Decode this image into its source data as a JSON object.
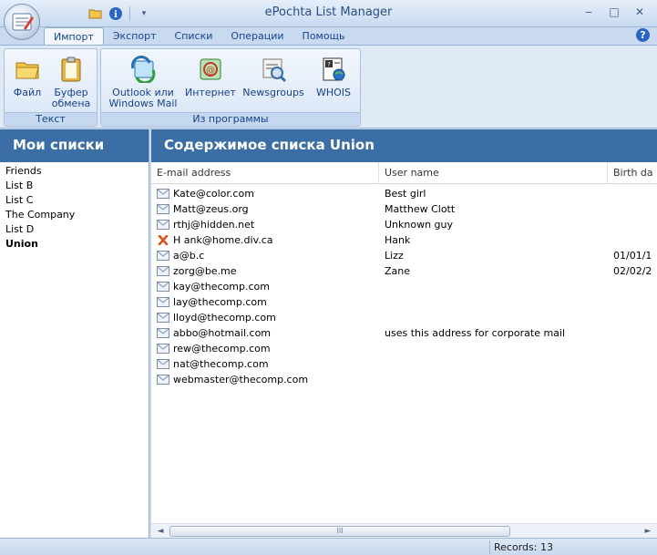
{
  "window": {
    "title": "ePochta List Manager",
    "controls": {
      "minimize": "‒",
      "maximize": "□",
      "close": "✕"
    }
  },
  "ribbon": {
    "tabs": [
      {
        "label": "Импорт",
        "active": true
      },
      {
        "label": "Экспорт",
        "active": false
      },
      {
        "label": "Списки",
        "active": false
      },
      {
        "label": "Операции",
        "active": false
      },
      {
        "label": "Помощь",
        "active": false
      }
    ],
    "groups": [
      {
        "label": "Текст",
        "buttons": [
          {
            "label": "Файл",
            "icon": "folder-icon"
          },
          {
            "label": "Буфер обмена",
            "icon": "clipboard-icon"
          }
        ]
      },
      {
        "label": "Из программы",
        "buttons": [
          {
            "label": "Outlook или Windows Mail",
            "icon": "outlook-icon"
          },
          {
            "label": "Интернет",
            "icon": "internet-icon"
          },
          {
            "label": "Newsgroups",
            "icon": "newsgroups-icon"
          },
          {
            "label": "WHOIS",
            "icon": "whois-icon"
          }
        ]
      }
    ]
  },
  "left": {
    "title": "Мои списки",
    "lists": [
      {
        "name": "Friends",
        "selected": false
      },
      {
        "name": "List B",
        "selected": false
      },
      {
        "name": "List C",
        "selected": false
      },
      {
        "name": "The Company",
        "selected": false
      },
      {
        "name": "List D",
        "selected": false
      },
      {
        "name": "Union",
        "selected": true
      }
    ]
  },
  "right": {
    "title": "Содержимое списка Union",
    "columns": [
      "E-mail address",
      "User name",
      "Birth da"
    ],
    "rows": [
      {
        "email": "Kate@color.com",
        "name": "Best girl",
        "birth": "",
        "invalid": false
      },
      {
        "email": "Matt@zeus.org",
        "name": "Matthew Clott",
        "birth": "",
        "invalid": false
      },
      {
        "email": "rthj@hidden.net",
        "name": "Unknown guy",
        "birth": "",
        "invalid": false
      },
      {
        "email": "H ank@home.div.ca",
        "name": "Hank",
        "birth": "",
        "invalid": true
      },
      {
        "email": "a@b.c",
        "name": "Lizz",
        "birth": "01/01/1",
        "invalid": false
      },
      {
        "email": "zorg@be.me",
        "name": "Zane",
        "birth": "02/02/2",
        "invalid": false
      },
      {
        "email": "kay@thecomp.com",
        "name": "",
        "birth": "",
        "invalid": false
      },
      {
        "email": "lay@thecomp.com",
        "name": "",
        "birth": "",
        "invalid": false
      },
      {
        "email": "lloyd@thecomp.com",
        "name": "",
        "birth": "",
        "invalid": false
      },
      {
        "email": "abbo@hotmail.com",
        "name": "uses this address for corporate mail",
        "birth": "",
        "invalid": false
      },
      {
        "email": "rew@thecomp.com",
        "name": "",
        "birth": "",
        "invalid": false
      },
      {
        "email": "nat@thecomp.com",
        "name": "",
        "birth": "",
        "invalid": false
      },
      {
        "email": "webmaster@thecomp.com",
        "name": "",
        "birth": "",
        "invalid": false
      }
    ]
  },
  "scrollbar": {
    "grip": "III",
    "left_arrow": "◄",
    "right_arrow": "►"
  },
  "status": {
    "records": "Records: 13"
  },
  "colors": {
    "header_blue": "#3b6ea5",
    "ribbon_text": "#15428b",
    "invalid_mark": "#d9531e"
  }
}
